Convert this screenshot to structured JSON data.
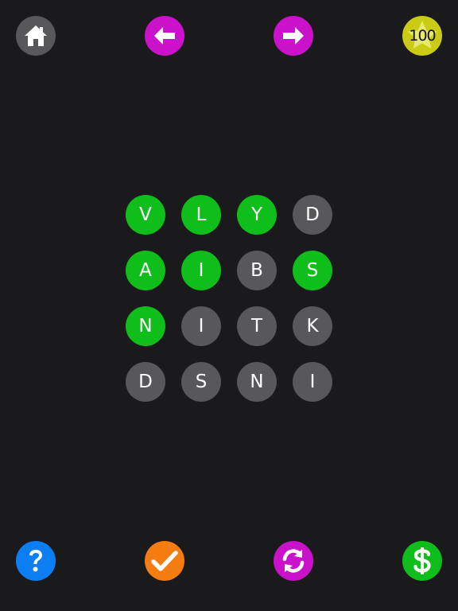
{
  "header": {
    "coins": "100"
  },
  "icons": {
    "home": "home-icon",
    "prev": "arrow-left-icon",
    "next": "arrow-right-icon",
    "coins": "star-icon",
    "help": "question-icon",
    "check": "check-icon",
    "refresh": "refresh-icon",
    "shop": "dollar-icon"
  },
  "colors": {
    "background": "#1a191b",
    "tile_selected": "#0fbe1a",
    "tile_idle": "#58575a",
    "magenta": "#c912c9",
    "coin_yellow": "#cbcb15",
    "help_blue": "#0b7ef4",
    "check_orange": "#f47c10",
    "shop_green": "#0fbe1a",
    "home_gray": "#58575a"
  },
  "grid": {
    "rows": [
      [
        {
          "letter": "V",
          "selected": true
        },
        {
          "letter": "L",
          "selected": true
        },
        {
          "letter": "Y",
          "selected": true
        },
        {
          "letter": "D",
          "selected": false
        }
      ],
      [
        {
          "letter": "A",
          "selected": true
        },
        {
          "letter": "I",
          "selected": true
        },
        {
          "letter": "B",
          "selected": false
        },
        {
          "letter": "S",
          "selected": true
        }
      ],
      [
        {
          "letter": "N",
          "selected": true
        },
        {
          "letter": "I",
          "selected": false
        },
        {
          "letter": "T",
          "selected": false
        },
        {
          "letter": "K",
          "selected": false
        }
      ],
      [
        {
          "letter": "D",
          "selected": false
        },
        {
          "letter": "S",
          "selected": false
        },
        {
          "letter": "N",
          "selected": false
        },
        {
          "letter": "I",
          "selected": false
        }
      ]
    ]
  }
}
